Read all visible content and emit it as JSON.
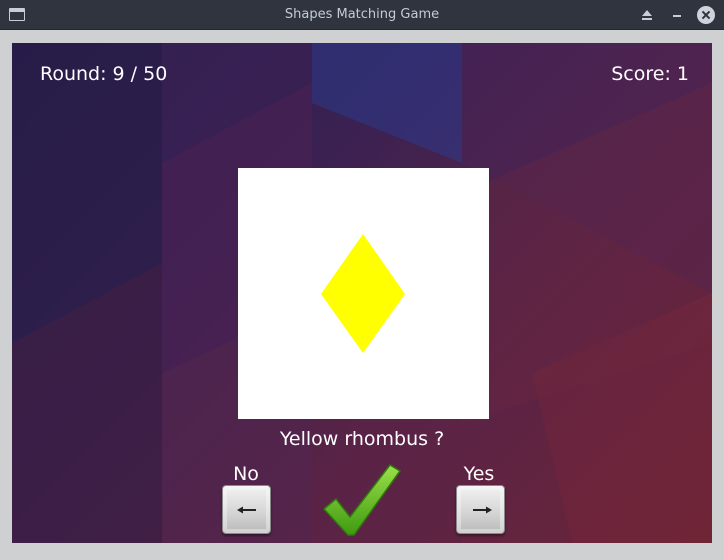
{
  "window": {
    "title": "Shapes Matching Game"
  },
  "hud": {
    "round": "Round: 9 / 50",
    "score": "Score: 1"
  },
  "card": {
    "shape": "rhombus",
    "shape_color": "#ffff00"
  },
  "question": "Yellow rhombus ?",
  "answers": {
    "no": {
      "label": "No",
      "key_icon": "left-arrow-icon"
    },
    "yes": {
      "label": "Yes",
      "key_icon": "right-arrow-icon"
    }
  },
  "feedback": {
    "icon": "checkmark-icon",
    "color": "#5fc21a"
  }
}
